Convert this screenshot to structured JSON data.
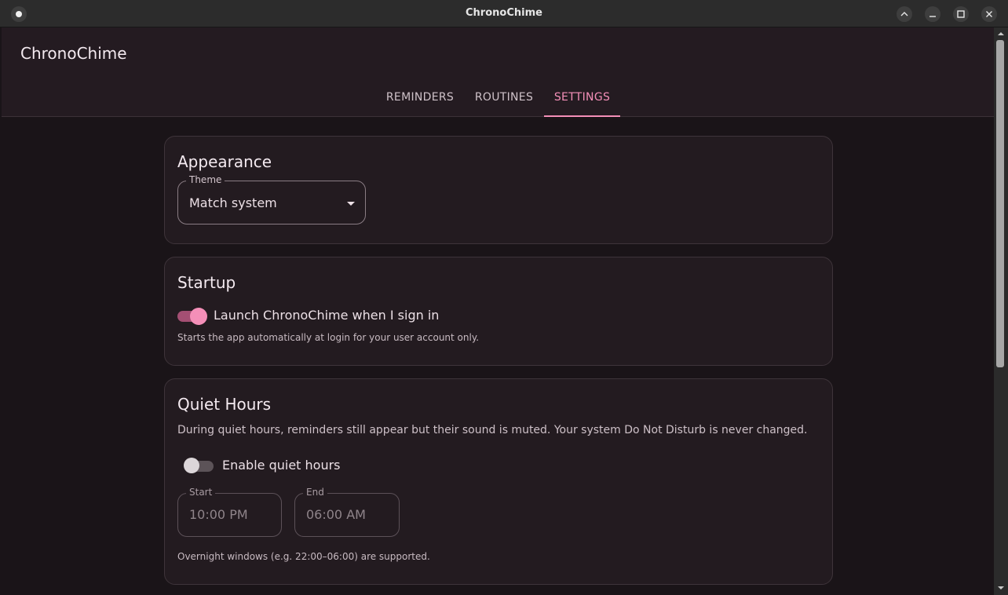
{
  "window": {
    "title": "ChronoChime",
    "buttons": [
      "chevron-up-icon",
      "minimize-icon",
      "maximize-icon",
      "close-icon"
    ]
  },
  "app": {
    "title": "ChronoChime"
  },
  "tabs": [
    {
      "label": "REMINDERS"
    },
    {
      "label": "ROUTINES"
    },
    {
      "label": "SETTINGS",
      "active": true
    }
  ],
  "appearance": {
    "heading": "Appearance",
    "theme_label": "Theme",
    "theme_value": "Match system"
  },
  "startup": {
    "heading": "Startup",
    "launch_label": "Launch ChronoChime when I sign in",
    "launch_enabled": true,
    "launch_hint": "Starts the app automatically at login for your user account only."
  },
  "quiet_hours": {
    "heading": "Quiet Hours",
    "description": "During quiet hours, reminders still appear but their sound is muted. Your system Do Not Disturb is never changed.",
    "enable_label": "Enable quiet hours",
    "enabled": false,
    "start_label": "Start",
    "start_value": "10:00 PM",
    "end_label": "End",
    "end_value": "06:00 AM",
    "hint": "Overnight windows (e.g. 22:00–06:00) are supported."
  },
  "colors": {
    "accent": "#f48fb8",
    "background": "#1a1418",
    "card": "#231b20"
  }
}
